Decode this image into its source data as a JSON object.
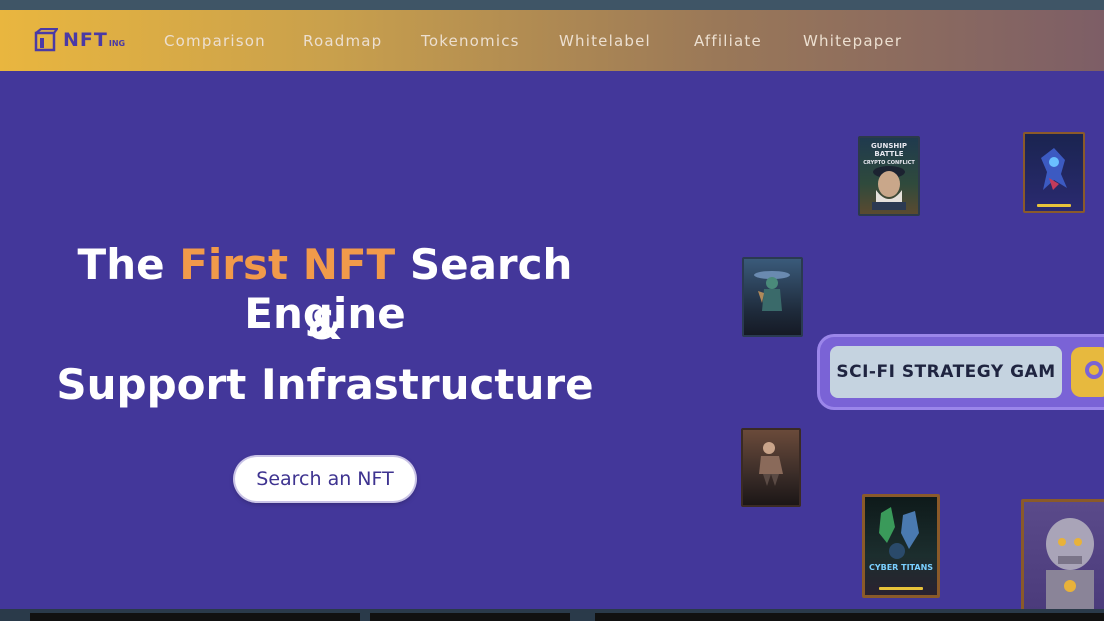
{
  "brand": {
    "logo_text": "NFT",
    "logo_sub": "ING"
  },
  "nav": {
    "items": [
      "Comparison",
      "Roadmap",
      "Tokenomics",
      "Whitelabel",
      "Affiliate",
      "Whitepaper"
    ]
  },
  "hero": {
    "line1_pre": "The ",
    "line1_accent": "First NFT",
    "line1_post": " Search Engine",
    "line2": "&",
    "line3": "Support Infrastructure",
    "cta_label": "Search an NFT"
  },
  "cards": [
    {
      "title": "GUNSHIP BATTLE",
      "subtitle": "CRYPTO CONFLICT"
    },
    {
      "title": "",
      "subtitle": ""
    },
    {
      "title": "",
      "subtitle": ""
    },
    {
      "title": "",
      "subtitle": ""
    },
    {
      "title": "CYBER TITANS",
      "subtitle": ""
    },
    {
      "title": "",
      "subtitle": ""
    }
  ],
  "search_pill": {
    "text": "SCI-FI STRATEGY GAM"
  },
  "colors": {
    "background": "#43379a",
    "accent": "#f19a4a",
    "nav_gold": "#e9b63f"
  }
}
